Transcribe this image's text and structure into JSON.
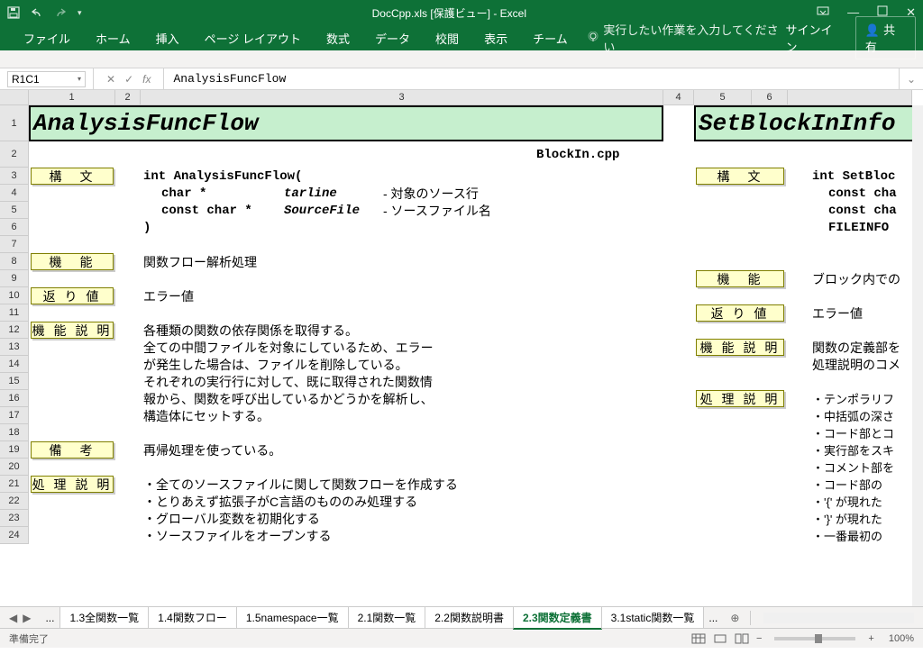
{
  "title": "DocCpp.xls [保護ビュー] - Excel",
  "ribbon": {
    "file": "ファイル",
    "home": "ホーム",
    "insert": "挿入",
    "layout": "ページ レイアウト",
    "formulas": "数式",
    "data": "データ",
    "review": "校閲",
    "view": "表示",
    "team": "チーム",
    "tellme": "実行したい作業を入力してください",
    "signin": "サインイン",
    "share": "共有"
  },
  "namebox": "R1C1",
  "formula": "AnalysisFuncFlow",
  "cols": {
    "n": [
      "1",
      "2",
      "3",
      "4",
      "5",
      "6"
    ]
  },
  "block1": {
    "title": "AnalysisFuncFlow",
    "file": "BlockIn.cpp",
    "labels": {
      "syntax": "構　文",
      "func": "機　能",
      "retval": "返 り 値",
      "funcdesc": "機 能 説 明",
      "note": "備　考",
      "procdesc": "処 理 説 明"
    },
    "syntax": {
      "l1": "int AnalysisFuncFlow(",
      "l2a": "char *",
      "l2b": "tarline",
      "l2c": "- 対象のソース行",
      "l3a": "const char *",
      "l3b": "SourceFile",
      "l3c": "- ソースファイル名",
      "l4": ")"
    },
    "func": "関数フロー解析処理",
    "retval": "エラー値",
    "desc": {
      "l1": "各種類の関数の依存関係を取得する。",
      "l2": "全ての中間ファイルを対象にしているため、エラー",
      "l3": "が発生した場合は、ファイルを削除している。",
      "l4": "それぞれの実行行に対して、既に取得された関数情",
      "l5": "報から、関数を呼び出しているかどうかを解析し、",
      "l6": "構造体にセットする。"
    },
    "note": "再帰処理を使っている。",
    "proc": {
      "l1": "・全てのソースファイルに関して関数フローを作成する",
      "l2": "・とりあえず拡張子がC言語のもののみ処理する",
      "l3": "・グローバル変数を初期化する",
      "l4": "・ソースファイルをオープンする"
    }
  },
  "block2": {
    "title": "SetBlockInInfo",
    "labels": {
      "syntax": "構　文",
      "func": "機　能",
      "retval": "返 り 値",
      "funcdesc": "機 能 説 明",
      "procdesc": "処 理 説 明"
    },
    "syntax": {
      "l1": "int SetBloc",
      "l2": "const cha",
      "l3": "const cha",
      "l4": "FILEINFO "
    },
    "func": "ブロック内での",
    "retval": "エラー値",
    "desc": {
      "l1": "関数の定義部を",
      "l2": "処理説明のコメ"
    },
    "proc": {
      "l1": "・テンポラリフ",
      "l2": "・中括弧の深さ",
      "l3": "・コード部とコ",
      "l4": "・実行部をスキ",
      "l5": "・コメント部を",
      "l6": "・コード部の",
      "l7": "・'{' が現れた",
      "l8": "・'}' が現れた",
      "l9": "・一番最初の"
    }
  },
  "tabs": {
    "ellipsis": "...",
    "t1": "1.3全関数一覧",
    "t2": "1.4関数フロー",
    "t3": "1.5namespace一覧",
    "t4": "2.1関数一覧",
    "t5": "2.2関数説明書",
    "t6": "2.3関数定義書",
    "t7": "3.1static関数一覧"
  },
  "status": {
    "ready": "準備完了",
    "zoom": "100%",
    "plus": "+",
    "minus": "−"
  }
}
